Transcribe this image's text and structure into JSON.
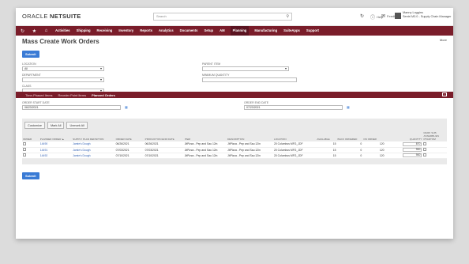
{
  "brand": {
    "logo_left": "ORACLE",
    "logo_right": "NETSUITE"
  },
  "search": {
    "placeholder": "Search"
  },
  "utils": {
    "help": "Help",
    "feedback": "Feedback"
  },
  "user": {
    "name": "Manny Loggins",
    "role": "Sentri M3.0 - Supply Chain Manager"
  },
  "nav": [
    "Activities",
    "Shipping",
    "Receiving",
    "Inventory",
    "Reports",
    "Analytics",
    "Documents",
    "Setup",
    "AM",
    "Planning",
    "Manufacturing",
    "SuiteApps",
    "Support"
  ],
  "nav_active": "Planning",
  "page": {
    "title": "Mass Create Work Orders",
    "more": "More",
    "submit": "Submit"
  },
  "filters": {
    "location_label": "LOCATION",
    "location_value": "All",
    "department_label": "DEPARTMENT",
    "department_value": "",
    "class_label": "CLASS",
    "class_value": "",
    "parent_item_label": "PARENT ITEM",
    "parent_item_value": "",
    "min_qty_label": "MINIMUM QUANTITY",
    "min_qty_value": ""
  },
  "tabs": [
    "Time-Phased Items",
    "Reorder Point Items",
    "Planned Orders"
  ],
  "tab_active": "Planned Orders",
  "dates": {
    "start_label": "ORDER START DATE",
    "start_value": "06/23/2021",
    "end_label": "ORDER END DATE",
    "end_value": "07/23/2021"
  },
  "sublist_buttons": [
    "Customize",
    "Mark All",
    "Unmark All"
  ],
  "columns": [
    "ORDER",
    "PLANNED ORDER ▲",
    "SUPPLY PLAN DEFINITION",
    "ORDER DATE",
    "PRODUCTION END DATE",
    "ITEM",
    "DESCRIPTION",
    "LOCATION",
    "AVAILABLE",
    "BACK ORDERED",
    "ON ORDER",
    "QUANTITY",
    "MARK SUB ASSEMBLIES PHANTOM"
  ],
  "rows": [
    {
      "planned": "14490",
      "definition": "Jamie's Dough",
      "order_date": "06/26/2021",
      "end_date": "06/26/2021",
      "item": "JitPizza - Pep and Sau 12in",
      "description": "JitPizza - Pep and Sau 12in",
      "location": "20 Columbus MFG_JDF",
      "available": "15",
      "back_ordered": "0",
      "on_order": "120",
      "quantity": "870"
    },
    {
      "planned": "14491",
      "definition": "Jamie's Dough",
      "order_date": "07/03/2021",
      "end_date": "07/03/2021",
      "item": "JitPizza - Pep and Sau 12in",
      "description": "JitPizza - Pep and Sau 12in",
      "location": "20 Columbus MFG_JDF",
      "available": "15",
      "back_ordered": "0",
      "on_order": "120",
      "quantity": "900"
    },
    {
      "planned": "14492",
      "definition": "Jamie's Dough",
      "order_date": "07/10/2021",
      "end_date": "07/10/2021",
      "item": "JitPizza - Pep and Sau 12in",
      "description": "JitPizza - Pep and Sau 12in",
      "location": "20 Columbus MFG_JDF",
      "available": "15",
      "back_ordered": "0",
      "on_order": "120",
      "quantity": "900"
    }
  ],
  "colors": {
    "nav_bg": "#7a1d2a",
    "primary_button": "#3a7bd5",
    "link": "#2f5fb3"
  }
}
